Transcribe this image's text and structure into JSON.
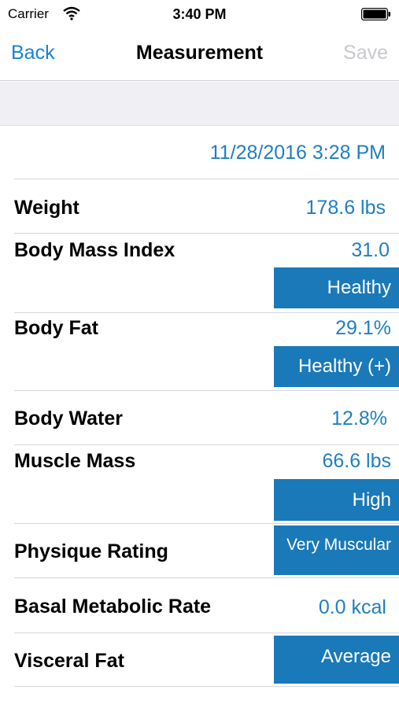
{
  "status_bar": {
    "carrier": "Carrier",
    "time": "3:40 PM"
  },
  "nav": {
    "back_label": "Back",
    "title": "Measurement",
    "save_label": "Save"
  },
  "measurement": {
    "date": "11/28/2016 3:28 PM",
    "weight": {
      "label": "Weight",
      "value": "178.6 lbs"
    },
    "bmi": {
      "label": "Body Mass Index",
      "value": "31.0",
      "badge": "Healthy"
    },
    "body_fat": {
      "label": "Body Fat",
      "value": "29.1%",
      "badge": "Healthy (+)"
    },
    "body_water": {
      "label": "Body Water",
      "value": "12.8%"
    },
    "muscle_mass": {
      "label": "Muscle Mass",
      "value": "66.6 lbs",
      "badge": "High"
    },
    "physique": {
      "label": "Physique Rating",
      "badge": "Very Muscular"
    },
    "bmr": {
      "label": "Basal Metabolic Rate",
      "value": "0.0 kcal"
    },
    "visceral_fat": {
      "label": "Visceral Fat",
      "badge": "Average"
    }
  },
  "colors": {
    "accent": "#1a82d8",
    "value_text": "#1f7fc0",
    "badge_bg": "#1a79b9",
    "disabled": "#c9c9ce",
    "group_bg": "#efeff4"
  }
}
